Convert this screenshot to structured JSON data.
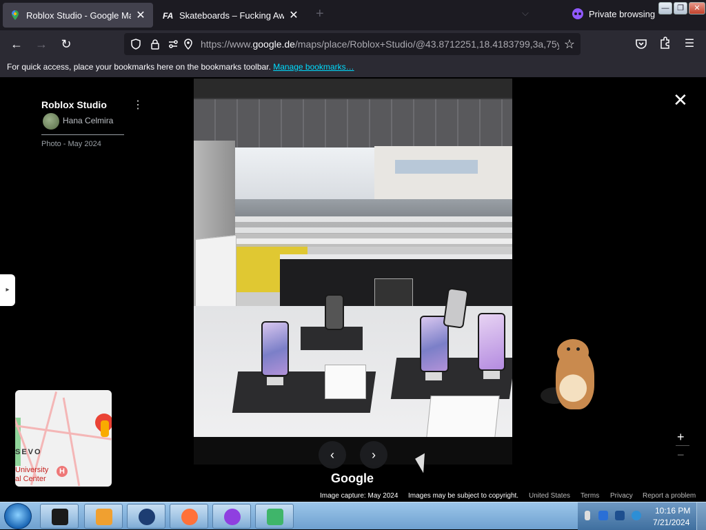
{
  "browser": {
    "tabs": [
      {
        "title": "Roblox Studio - Google Maps",
        "active": true,
        "favicon": "google-maps-pin-icon"
      },
      {
        "title": "Skateboards – Fucking Awesome",
        "active": false,
        "favicon": "fa-logo-icon"
      }
    ],
    "new_tab_glyph": "+",
    "tab_list_glyph": "⌵",
    "private_label": "Private browsing",
    "window_controls": {
      "minimize": "—",
      "restore": "❐",
      "close": "✕"
    },
    "nav": {
      "back": "←",
      "forward": "→",
      "reload": "↻"
    },
    "url_prefix": "https://www.",
    "url_domain": "google.de",
    "url_rest": "/maps/place/Roblox+Studio/@43.8712251,18.4183799,3a,75y",
    "bookmarks_message": "For quick access, place your bookmarks here on the bookmarks toolbar.",
    "bookmarks_link": "Manage bookmarks…"
  },
  "viewer": {
    "place_title": "Roblox Studio",
    "menu_glyph": "⋮",
    "author_name": "Hana Celmira",
    "photo_date": "Photo - May 2024",
    "close_glyph": "✕",
    "side_toggle_glyph": "▸",
    "prev_glyph": "‹",
    "next_glyph": "›",
    "logo_text": "Google",
    "zoom_in": "+",
    "zoom_out": "−",
    "minimap": {
      "label_top": "SEVO",
      "label_bottom": "University\nal Center",
      "hospital_glyph": "H"
    },
    "footer": {
      "capture": "Image capture: May 2024",
      "subject": "Images may be subject to copyright.",
      "country": "United States",
      "terms": "Terms",
      "privacy": "Privacy",
      "report": "Report a problem"
    }
  },
  "taskbar": {
    "apps": [
      {
        "name": "monitor-app",
        "color": "#1b1b1b"
      },
      {
        "name": "media-player-app",
        "color": "#f0a030"
      },
      {
        "name": "globe-app",
        "color": "#1d3d72"
      },
      {
        "name": "firefox-app",
        "color": "#ff7139"
      },
      {
        "name": "private-browsing-app",
        "color": "#8f3fe0"
      },
      {
        "name": "sync-app",
        "color": "#3fb56a"
      }
    ],
    "clock_time": "10:16 PM",
    "clock_date": "7/21/2024"
  }
}
